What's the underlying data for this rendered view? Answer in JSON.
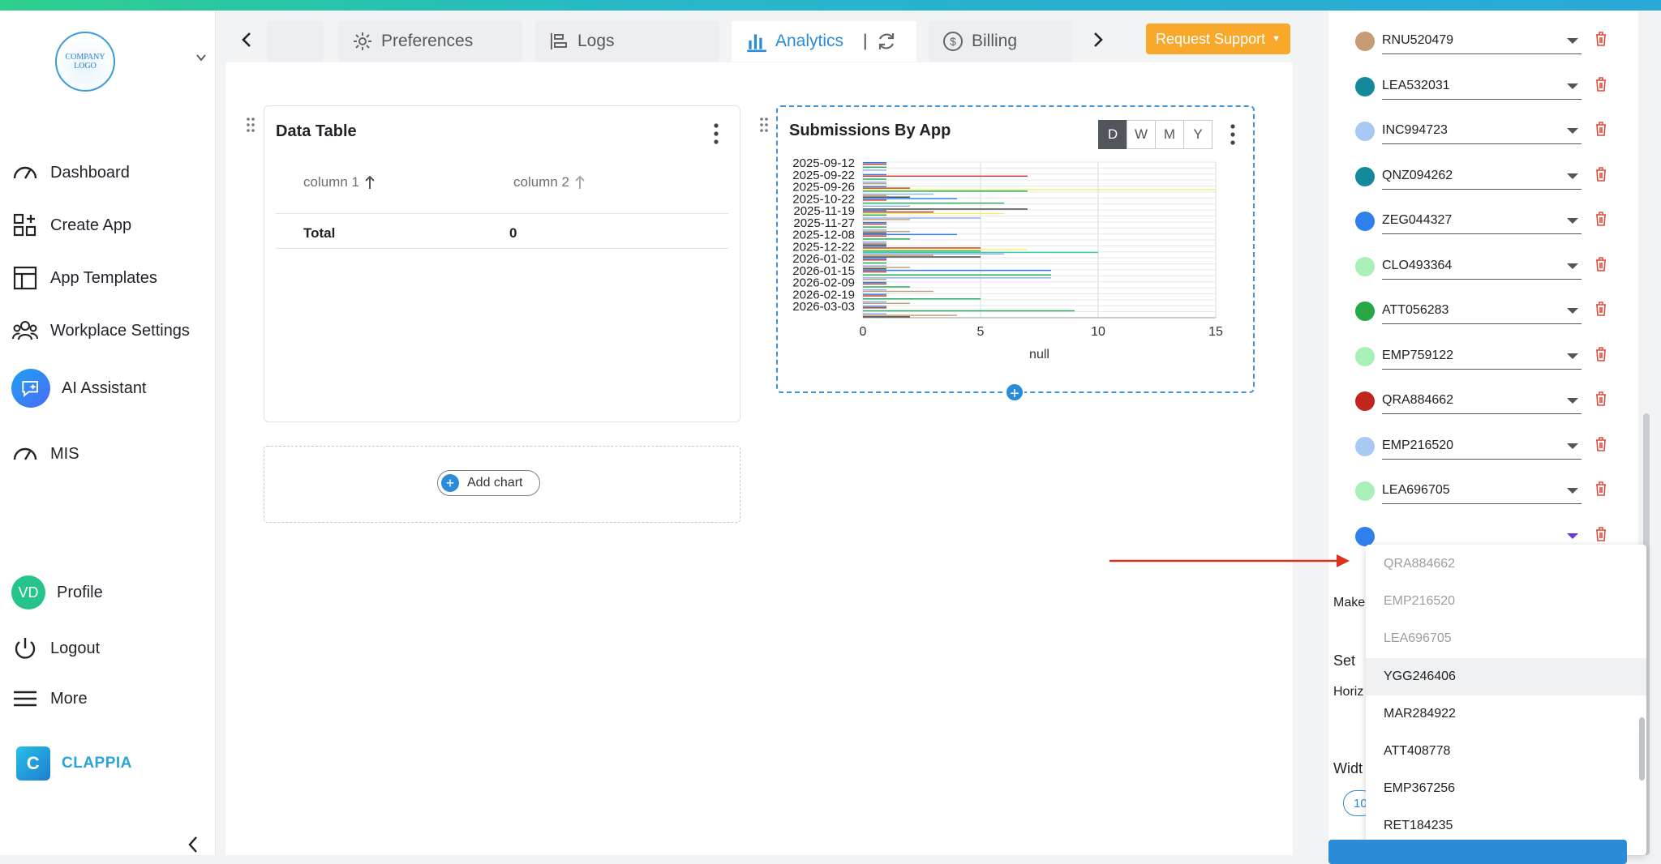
{
  "sidebar": {
    "logo_text": "COMPANY LOGO",
    "items": [
      {
        "label": "Dashboard"
      },
      {
        "label": "Create App"
      },
      {
        "label": "App Templates"
      },
      {
        "label": "Workplace Settings"
      },
      {
        "label": "AI Assistant"
      },
      {
        "label": "MIS"
      },
      {
        "label": "Profile",
        "initials": "VD"
      },
      {
        "label": "Logout"
      },
      {
        "label": "More"
      }
    ],
    "brand": "CLAPPIA"
  },
  "tabs": {
    "items": [
      {
        "label": ""
      },
      {
        "label": "Preferences"
      },
      {
        "label": "Logs"
      },
      {
        "label": "Analytics"
      },
      {
        "label": "Billing"
      }
    ],
    "request_support": "Request Support"
  },
  "data_table": {
    "title": "Data Table",
    "columns": [
      "column 1",
      "column 2"
    ],
    "total_label": "Total",
    "total_value": "0"
  },
  "add_chart": "Add chart",
  "chart": {
    "title": "Submissions By App",
    "periods": [
      "D",
      "W",
      "M",
      "Y"
    ],
    "active_period": "D"
  },
  "chart_data": {
    "type": "bar",
    "orientation": "horizontal",
    "title": "Submissions By App",
    "xlabel": "null",
    "xlim": [
      0,
      15
    ],
    "xticks": [
      "0",
      "5",
      "10",
      "15"
    ],
    "categories": [
      "2025-09-12",
      "2025-09-22",
      "2025-09-26",
      "2025-10-22",
      "2025-11-19",
      "2025-11-27",
      "2025-12-08",
      "2025-12-22",
      "2026-01-02",
      "2026-01-15",
      "2026-02-09",
      "2026-02-19",
      "2026-03-03"
    ],
    "series": [
      {
        "color": "#2f80ed",
        "values": [
          1,
          1,
          1,
          4,
          1,
          1,
          4,
          1,
          1,
          8,
          1,
          1,
          1
        ]
      },
      {
        "color": "#c0392b",
        "values": [
          1,
          7,
          2,
          1,
          3,
          1,
          1,
          5,
          1,
          1,
          1,
          1,
          1
        ]
      },
      {
        "color": "#f4f06b",
        "values": [
          0,
          0,
          15,
          0,
          6,
          0,
          0,
          7,
          0,
          0,
          0,
          0,
          0
        ]
      },
      {
        "color": "#27ae60",
        "values": [
          1,
          1,
          7,
          6,
          1,
          1,
          2,
          5,
          1,
          8,
          2,
          5,
          9
        ]
      },
      {
        "color": "#2dd4a6",
        "values": [
          0,
          0,
          0,
          0,
          0,
          0,
          0,
          10,
          0,
          0,
          0,
          0,
          0
        ]
      },
      {
        "color": "#8fb0e8",
        "values": [
          1,
          1,
          3,
          2,
          5,
          1,
          1,
          6,
          1,
          8,
          1,
          1,
          1
        ]
      },
      {
        "color": "#c69c72",
        "values": [
          0,
          1,
          1,
          0,
          2,
          2,
          1,
          3,
          2,
          1,
          3,
          2,
          4
        ]
      },
      {
        "color": "#444444",
        "values": [
          0,
          0,
          2,
          7,
          0,
          1,
          1,
          5,
          1,
          0,
          0,
          0,
          2
        ]
      }
    ]
  },
  "panel": {
    "rows": [
      {
        "value": "RNU520479",
        "color": "#c69c72"
      },
      {
        "value": "LEA532031",
        "color": "#13899a"
      },
      {
        "value": "INC994723",
        "color": "#a9c9f5"
      },
      {
        "value": "QNZ094262",
        "color": "#13899a"
      },
      {
        "value": "ZEG044327",
        "color": "#2f80ed"
      },
      {
        "value": "CLO493364",
        "color": "#a8efb8"
      },
      {
        "value": "ATT056283",
        "color": "#27a844"
      },
      {
        "value": "EMP759122",
        "color": "#a8efb8"
      },
      {
        "value": "QRA884662",
        "color": "#c0261e"
      },
      {
        "value": "EMP216520",
        "color": "#a9c9f5"
      },
      {
        "value": "LEA696705",
        "color": "#a8efb8"
      },
      {
        "value": "",
        "color": "#2f80ed"
      }
    ],
    "label_make": "Make",
    "label_set": "Set",
    "label_horiz": "Horiz",
    "label_width": "Widt",
    "width_value": "10"
  },
  "dropdown": {
    "options": [
      {
        "label": "QRA884662",
        "disabled": true
      },
      {
        "label": "EMP216520",
        "disabled": true
      },
      {
        "label": "LEA696705",
        "disabled": true
      },
      {
        "label": "YGG246406",
        "disabled": false
      },
      {
        "label": "MAR284922",
        "disabled": false
      },
      {
        "label": "ATT408778",
        "disabled": false
      },
      {
        "label": "EMP367256",
        "disabled": false
      },
      {
        "label": "RET184235",
        "disabled": false
      }
    ]
  }
}
